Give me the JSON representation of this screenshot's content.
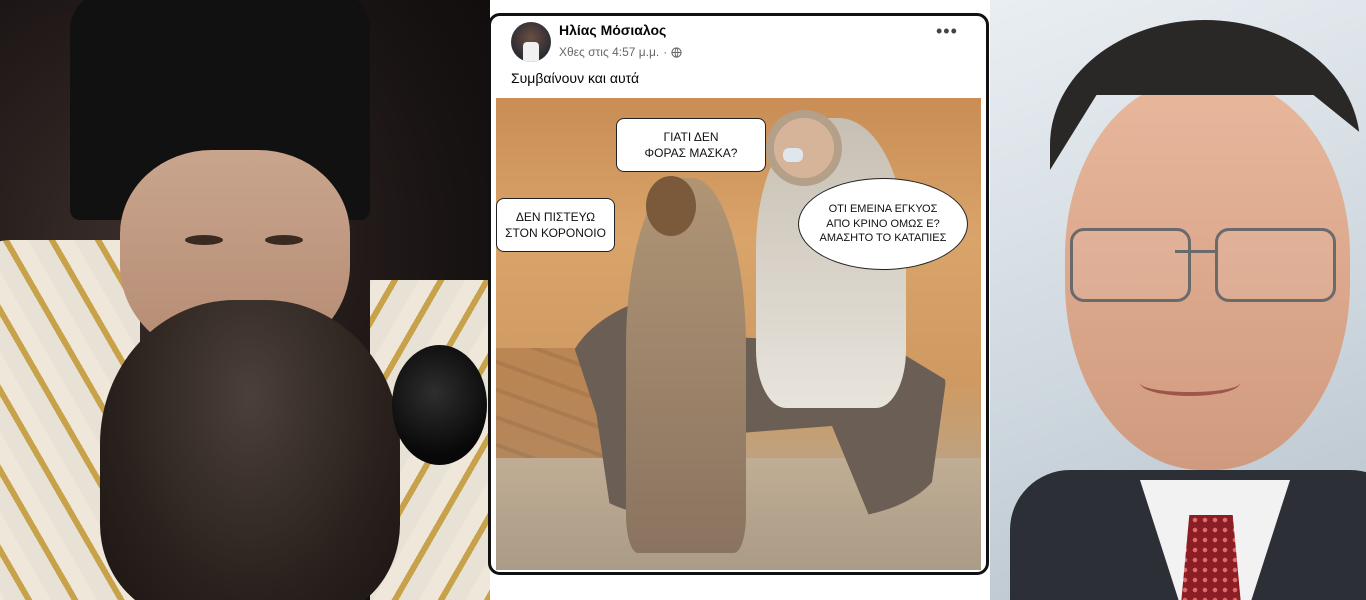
{
  "post": {
    "author_name": "Ηλίας Μόσιαλος",
    "timestamp": "Χθες στις 4:57 μ.μ.",
    "separator": "·",
    "privacy_icon": "globe-icon",
    "more_icon": "ellipsis-icon",
    "more_label": "•••",
    "text": "Συμβαίνουν και αυτά"
  },
  "meme": {
    "bubble_mary_question": "ΓΙΑΤΙ ΔΕΝ\nΦΟΡΑΣ ΜΑΣΚΑ?",
    "bubble_joseph": "ΔΕΝ ΠΙΣΤΕΥΩ\nΣΤΟΝ ΚΟΡΟΝΟΙΟ",
    "bubble_mary_reply": "ΟΤΙ ΕΜΕΙΝΑ ΕΓΚΥΟΣ\nΑΠΟ ΚΡΙΝΟ ΟΜΩΣ Ε?\nΑΜΑΣΗΤΟ ΤΟ ΚΑΤΑΠΙΕΣ"
  },
  "colors": {
    "card_border": "#111111",
    "name_text": "#050505",
    "meta_text": "#65676b"
  }
}
